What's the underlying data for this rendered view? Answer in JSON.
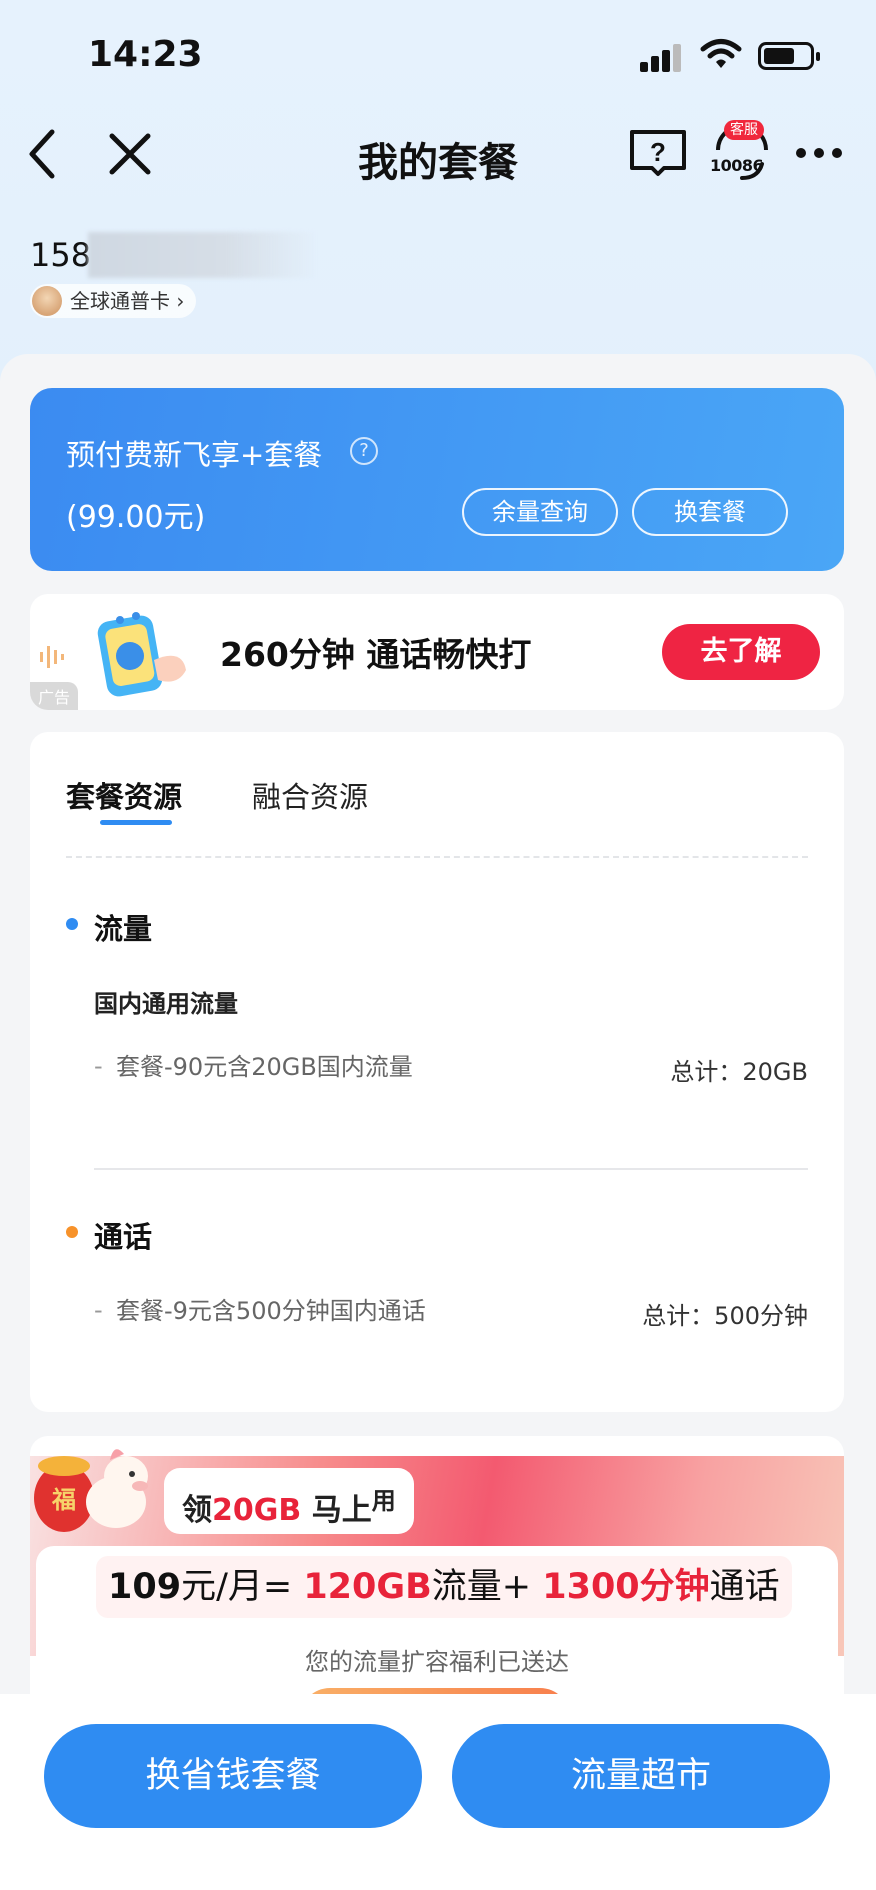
{
  "status_bar": {
    "time": "14:23"
  },
  "nav": {
    "title": "我的套餐",
    "help_label": "?",
    "service_badge": "客服",
    "service_number": "10086"
  },
  "account": {
    "phone_prefix": "158",
    "card_label": "全球通普卡 ›"
  },
  "plan": {
    "name": "预付费新飞享+套餐",
    "help_label": "?",
    "price": "(99.00元)",
    "balance_button": "余量查询",
    "change_button": "换套餐"
  },
  "ad": {
    "text": "260分钟 通话畅快打",
    "tag": "广告",
    "button": "去了解"
  },
  "resources": {
    "tabs": [
      "套餐资源",
      "融合资源"
    ],
    "active_tab": "套餐资源",
    "data_section": {
      "title": "流量",
      "dot_color": "#2f8cf2",
      "subtitle": "国内通用流量",
      "item_dash": "-",
      "item_name": "套餐-90元含20GB国内流量",
      "item_total": "总计：20GB"
    },
    "call_section": {
      "title": "通话",
      "dot_color": "#f7922a",
      "item_dash": "-",
      "item_name": "套餐-9元含500分钟国内通话",
      "item_total": "总计：500分钟"
    }
  },
  "promo": {
    "tag_prefix": "领",
    "tag_highlight": "20GB",
    "tag_suffix": " 马上",
    "tag_sup": "用",
    "price": "109",
    "price_unit": "元/月= ",
    "data_amount": "120GB",
    "data_label": "流量+ ",
    "call_amount": "1300分钟",
    "call_label": "通话",
    "subtitle": "您的流量扩容福利已送达",
    "mascot_char": "福"
  },
  "bottom": {
    "left_button": "换省钱套餐",
    "right_button": "流量超市"
  },
  "colors": {
    "accent_blue": "#2f8cf2",
    "promo_red": "#e8233a",
    "ad_button": "#ef2443"
  }
}
